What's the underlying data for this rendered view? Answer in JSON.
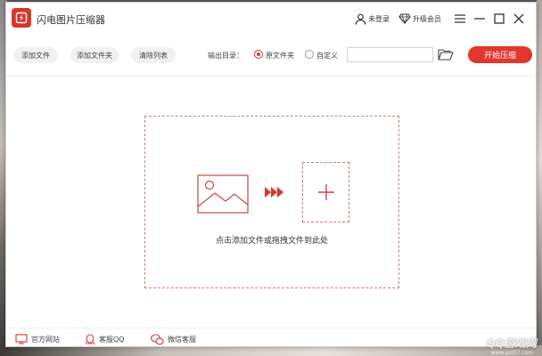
{
  "app": {
    "title": "闪电图片压缩器"
  },
  "titlebar": {
    "login_label": "未登录",
    "upgrade_label": "升级会员",
    "icons": [
      "user-icon",
      "diamond-icon",
      "menu-icon",
      "minimize-icon",
      "maximize-icon",
      "close-icon"
    ]
  },
  "toolbar": {
    "add_file": "添加文件",
    "add_folder": "添加文件夹",
    "clear_list": "清除列表",
    "output_label": "输出目录：",
    "radio_original": "原文件夹",
    "radio_custom": "自定义",
    "output_selected": "原文件夹",
    "path_value": "",
    "start_button": "开始压缩"
  },
  "dropzone": {
    "hint": "点击添加文件或拖拽文件到此处"
  },
  "footer": {
    "website": "官方网站",
    "qq": "客服QQ",
    "wechat": "微信客服"
  },
  "watermark": {
    "text": "QQ游戏网",
    "url": "www.yxl07.com"
  },
  "colors": {
    "accent": "#e2372c",
    "border_dashed": "#d97a72"
  }
}
